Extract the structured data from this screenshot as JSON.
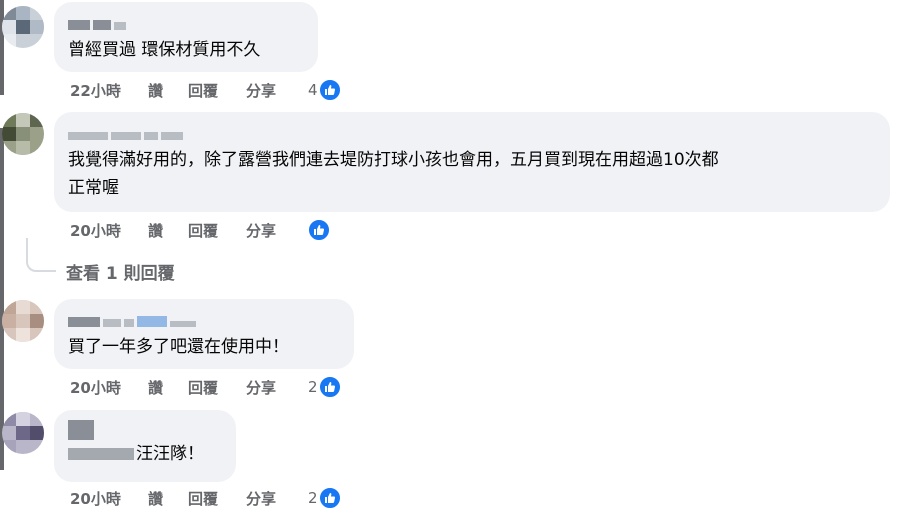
{
  "comments": [
    {
      "text": "曾經買過 環保材質用不久",
      "time": "22小時",
      "like": "讚",
      "reply": "回覆",
      "share": "分享",
      "reactions": "4"
    },
    {
      "text": "我覺得滿好用的，除了露營我們連去堤防打球小孩也會用，五月買到現在用超過10次都\n正常喔",
      "time": "20小時",
      "like": "讚",
      "reply": "回覆",
      "share": "分享",
      "reactions": ""
    },
    {
      "text": "買了一年多了吧還在使用中！",
      "time": "20小時",
      "like": "讚",
      "reply": "回覆",
      "share": "分享",
      "reactions": "2"
    },
    {
      "text": "汪汪隊！",
      "time": "20小時",
      "like": "讚",
      "reply": "回覆",
      "share": "分享",
      "reactions": "2"
    }
  ],
  "view_replies": "查看 1 則回覆",
  "colors": {
    "bubble": "#f0f2f5",
    "like_blue": "#1877f2",
    "meta_gray": "#65676b"
  }
}
